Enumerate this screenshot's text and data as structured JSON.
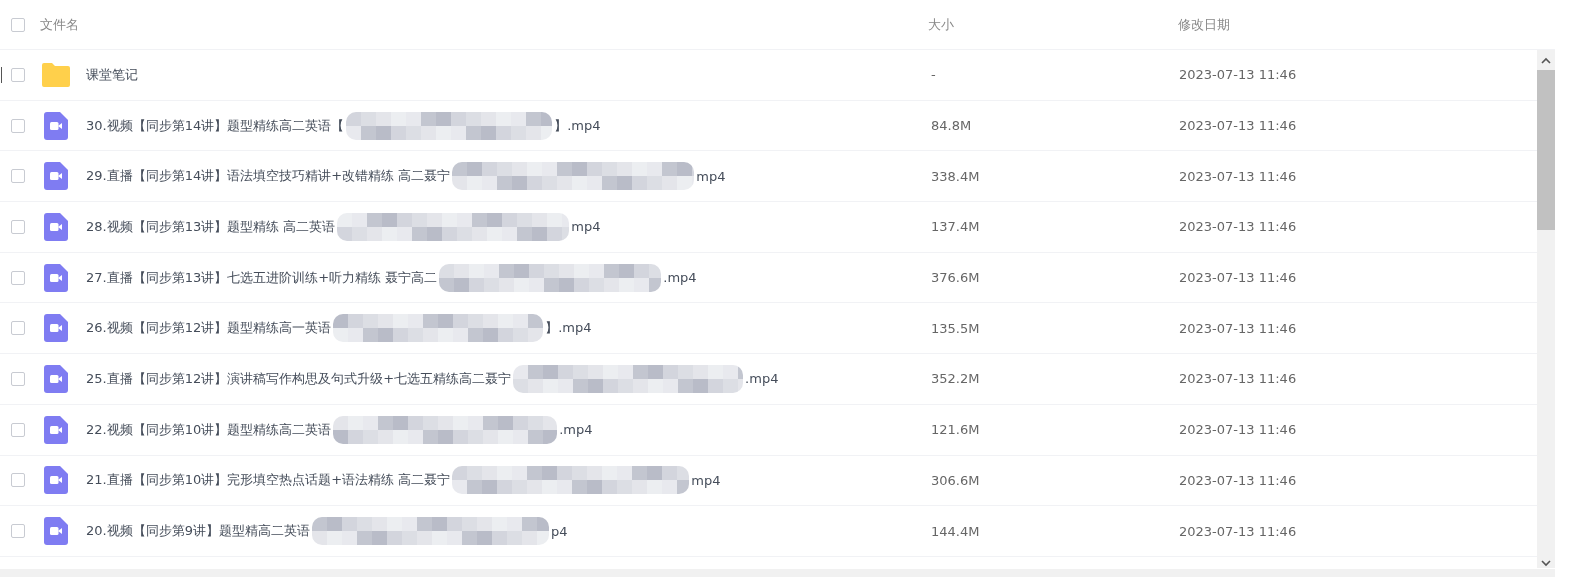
{
  "header": {
    "select_all": {
      "checked": false
    },
    "columns": [
      "文件名",
      "大小",
      "修改日期"
    ]
  },
  "rows": [
    {
      "kind": "folder",
      "checked": false,
      "name": "课堂笔记",
      "size": "-",
      "date": "2023-07-13 11:46"
    },
    {
      "kind": "video",
      "checked": false,
      "name": "30.视频【同步第14讲】题型精练高二英语【",
      "suffix": "】.mp4",
      "size": "84.8M",
      "date": "2023-07-13 11:46"
    },
    {
      "kind": "video",
      "checked": false,
      "name": "29.直播【同步第14讲】语法填空技巧精讲+改错精练 高二聂宁",
      "suffix": "mp4",
      "size": "338.4M",
      "date": "2023-07-13 11:46"
    },
    {
      "kind": "video",
      "checked": false,
      "name": "28.视频【同步第13讲】题型精练 高二英语",
      "suffix": "mp4",
      "size": "137.4M",
      "date": "2023-07-13 11:46"
    },
    {
      "kind": "video",
      "checked": false,
      "name": "27.直播【同步第13讲】七选五进阶训练+听力精练 聂宁高二",
      "suffix": ".mp4",
      "size": "376.6M",
      "date": "2023-07-13 11:46"
    },
    {
      "kind": "video",
      "checked": false,
      "name": "26.视频【同步第12讲】题型精练高一英语",
      "suffix": "】.mp4",
      "size": "135.5M",
      "date": "2023-07-13 11:46"
    },
    {
      "kind": "video",
      "checked": false,
      "name": "25.直播【同步第12讲】演讲稿写作构思及句式升级+七选五精练高二聂宁",
      "suffix": ".mp4",
      "size": "352.2M",
      "date": "2023-07-13 11:46"
    },
    {
      "kind": "video",
      "checked": false,
      "name": "22.视频【同步第10讲】题型精练高二英语",
      "suffix": ".mp4",
      "size": "121.6M",
      "date": "2023-07-13 11:46"
    },
    {
      "kind": "video",
      "checked": false,
      "name": "21.直播【同步第10讲】完形填空热点话题+语法精练 高二聂宁",
      "suffix": "mp4",
      "size": "306.6M",
      "date": "2023-07-13 11:46"
    },
    {
      "kind": "video",
      "checked": false,
      "name": "20.视频【同步第9讲】题型精高二英语",
      "suffix": "p4",
      "size": "144.4M",
      "date": "2023-07-13 11:46"
    }
  ]
}
